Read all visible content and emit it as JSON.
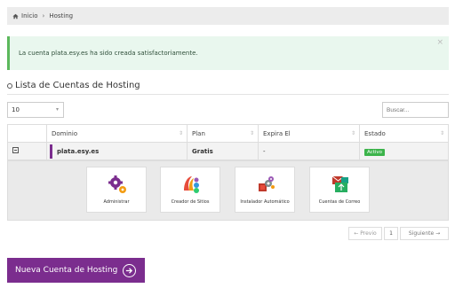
{
  "breadcrumb": {
    "home": "Inicio",
    "separator": "›",
    "current": "Hosting"
  },
  "alert": {
    "message": "La cuenta plata.esy.es ha sido creada satisfactoriamente.",
    "close": "×"
  },
  "section": {
    "title": "Lista de Cuentas de Hosting"
  },
  "controls": {
    "page_size": "10",
    "page_size_arrow": "▾",
    "search_placeholder": "Buscar..."
  },
  "table": {
    "headers": [
      "Dominio",
      "Plan",
      "Expira El",
      "Estado"
    ],
    "row": {
      "domain": "plata.esy.es",
      "plan": "Gratis",
      "expires": "-",
      "status": "Activo"
    }
  },
  "tiles": [
    {
      "label": "Administrar",
      "icon": "gears-icon"
    },
    {
      "label": "Creador de Sitios",
      "icon": "site-builder-icon"
    },
    {
      "label": "Instalador Automático",
      "icon": "auto-installer-icon"
    },
    {
      "label": "Cuentas de Correo",
      "icon": "mail-accounts-icon"
    }
  ],
  "pagination": {
    "prev": "← Previo",
    "page": "1",
    "next": "Siguiente →"
  },
  "new_button": {
    "label": "Nueva Cuenta de Hosting",
    "icon": "arrow-right-circle-icon"
  },
  "colors": {
    "accent": "#7b2d8e",
    "success": "#3cb44b",
    "alert_bg": "#e9f7ee"
  }
}
